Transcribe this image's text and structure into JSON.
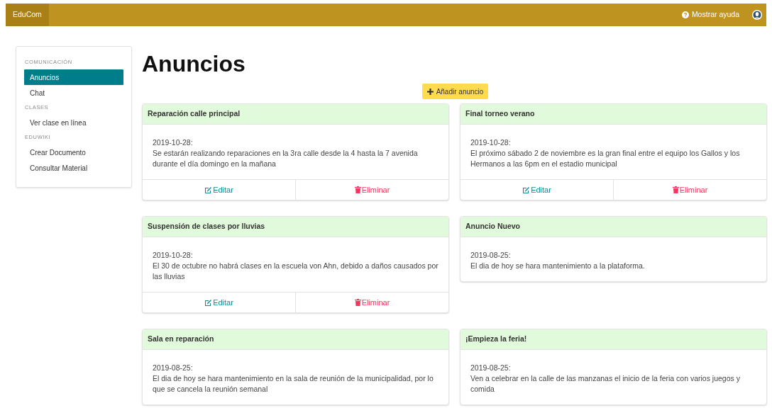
{
  "navbar": {
    "brand": "EduCom",
    "help": "Mostrar ayuda"
  },
  "sidebar": {
    "sections": [
      {
        "heading": "COMUNICACIÓN",
        "items": [
          {
            "label": "Anuncios",
            "selected": true
          },
          {
            "label": "Chat",
            "selected": false
          }
        ]
      },
      {
        "heading": "CLASES",
        "items": [
          {
            "label": "Ver clase en línea",
            "selected": false
          }
        ]
      },
      {
        "heading": "EDUWIKI",
        "items": [
          {
            "label": "Crear Documento",
            "selected": false
          },
          {
            "label": "Consultar Material",
            "selected": false
          }
        ]
      }
    ]
  },
  "page_title": "Anuncios",
  "add_button": "Añadir anuncio",
  "announcements": [
    {
      "title": "Reparación calle principal",
      "date": "2019-10-28:",
      "body": "Se estarán realizando reparaciones en la 3ra calle desde la 4 hasta la 7 avenida durante el día domingo en la mañana",
      "actions": [
        {
          "kind": "edit",
          "label": "Editar"
        },
        {
          "kind": "delete",
          "label": "Eliminar"
        }
      ]
    },
    {
      "title": "Final torneo verano",
      "date": "2019-10-28:",
      "body": "El próximo sábado 2 de noviembre es la gran final entre el equipo los Gallos y los Hermanos a las 6pm en el estadio municipal",
      "actions": [
        {
          "kind": "edit",
          "label": "Editar"
        },
        {
          "kind": "delete",
          "label": "Eliminar"
        }
      ]
    },
    {
      "title": "Suspensión de clases por lluvias",
      "date": "2019-10-28:",
      "body": "El 30 de octubre no habrá clases en la escuela von Ahn, debido a daños causados por las lluvias",
      "actions": [
        {
          "kind": "edit",
          "label": "Editar"
        },
        {
          "kind": "delete",
          "label": "Eliminar"
        }
      ]
    },
    {
      "title": "Anuncio Nuevo",
      "date": "2019-08-25:",
      "body": "El dia de hoy se hara mantenimiento a la plataforma."
    },
    {
      "title": "Sala en reparación",
      "date": "2019-08-25:",
      "body": "El dia de hoy se hara mantenimiento en la sala de reunión de la municipalidad, por lo que se cancela la reunión semanal"
    },
    {
      "title": "¡Empieza la feria!",
      "date": "2019-08-25:",
      "body": "Ven a celebrar en la calle de las manzanas el inicio de la feria con varios juegos y comida"
    }
  ]
}
